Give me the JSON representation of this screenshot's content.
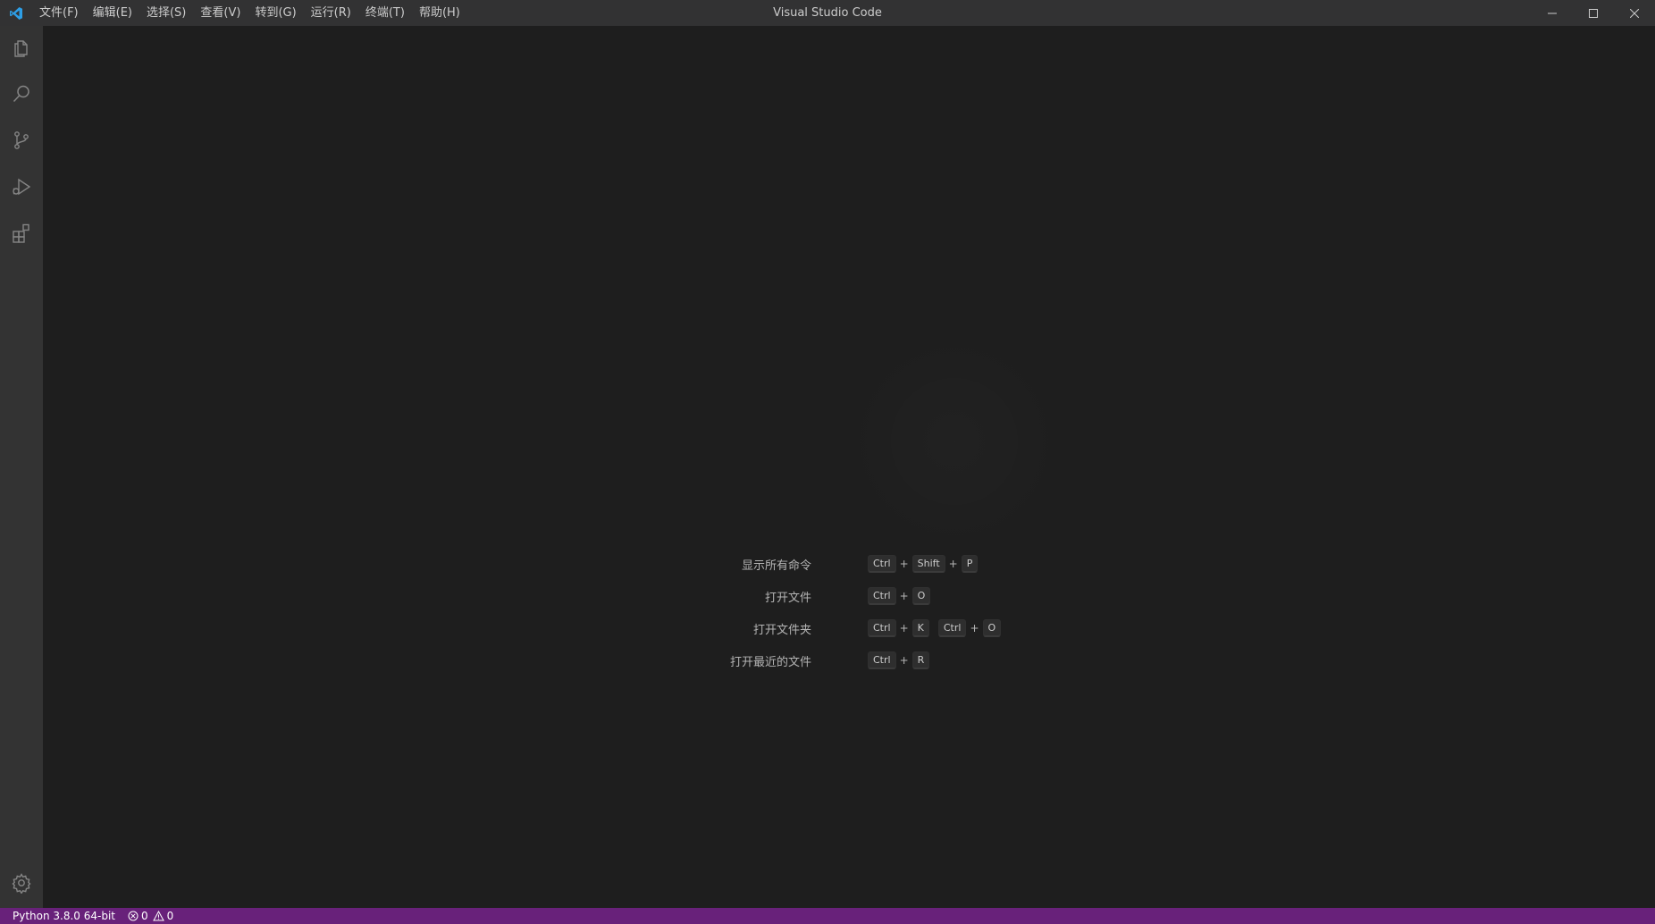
{
  "titlebar": {
    "window_title": "Visual Studio Code",
    "menus": [
      "文件(F)",
      "编辑(E)",
      "选择(S)",
      "查看(V)",
      "转到(G)",
      "运行(R)",
      "终端(T)",
      "帮助(H)"
    ]
  },
  "activitybar": {
    "icons": [
      "explorer-icon",
      "search-icon",
      "source-control-icon",
      "run-debug-icon",
      "extensions-icon"
    ],
    "bottom_icon": "gear-icon"
  },
  "editor": {
    "shortcuts": [
      {
        "label": "显示所有命令",
        "keys": [
          [
            "Ctrl",
            "Shift",
            "P"
          ]
        ]
      },
      {
        "label": "打开文件",
        "keys": [
          [
            "Ctrl",
            "O"
          ]
        ]
      },
      {
        "label": "打开文件夹",
        "keys": [
          [
            "Ctrl",
            "K"
          ],
          [
            "Ctrl",
            "O"
          ]
        ]
      },
      {
        "label": "打开最近的文件",
        "keys": [
          [
            "Ctrl",
            "R"
          ]
        ]
      }
    ],
    "plus": "+"
  },
  "statusbar": {
    "interpreter": "Python 3.8.0 64-bit",
    "errors": "0",
    "warnings": "0",
    "background": "#68217a"
  },
  "colors": {
    "accent": "#0078d4",
    "titlebar_bg": "#323233",
    "activitybar_bg": "#333333",
    "editor_bg": "#1e1e1e"
  }
}
